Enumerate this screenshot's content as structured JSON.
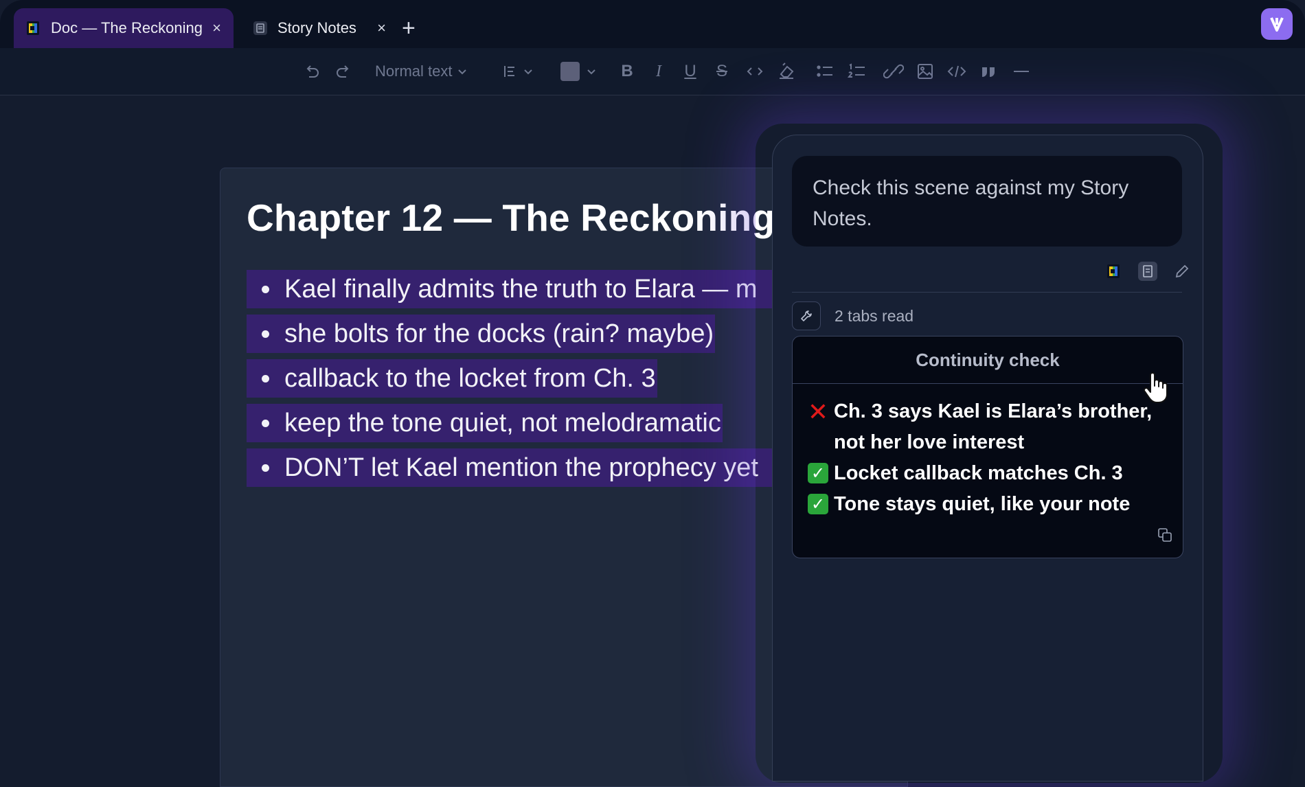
{
  "tabs": [
    {
      "title": "Doc — The Reckoning",
      "close": "×",
      "favicon": "doc-color-icon"
    },
    {
      "title": "Story Notes",
      "close": "×",
      "favicon": "notes-page-icon"
    }
  ],
  "new_tab": "+",
  "toolbar": {
    "text_style": "Normal text",
    "color_swatch": "#5c6079"
  },
  "document": {
    "title": "Chapter 12 — The Reckoning",
    "bullets": [
      "Kael finally admits the truth to Elara — m",
      "she bolts for the docks (rain? maybe)",
      "callback to the locket from Ch. 3",
      "keep the tone quiet, not melodramatic",
      "DON’T let Kael mention the prophecy yet"
    ]
  },
  "assistant": {
    "prompt": "Check this scene against my Story Notes.",
    "tool_status": "2 tabs read",
    "result": {
      "header": "Continuity check",
      "items": [
        {
          "status": "fail",
          "text": "Ch. 3 says Kael is Elara’s brother, not her love interest"
        },
        {
          "status": "pass",
          "text": "Locket callback matches Ch. 3"
        },
        {
          "status": "pass",
          "text": "Tone stays quiet, like your note"
        }
      ],
      "fail_mark": "✕",
      "pass_mark": "✓"
    }
  },
  "colors": {
    "accent": "#8c6cf0",
    "highlight": "#36216e",
    "active_tab": "#2e1a5e"
  }
}
